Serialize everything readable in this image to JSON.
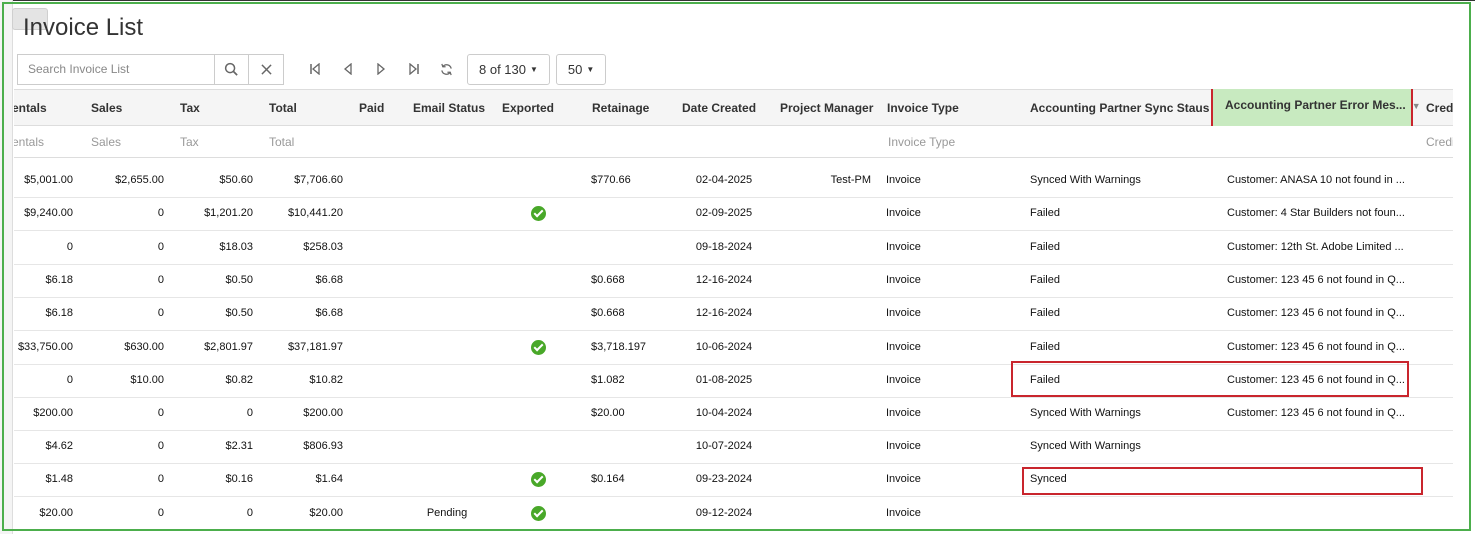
{
  "page": {
    "title": "Invoice List"
  },
  "toolbar": {
    "search_placeholder": "Search Invoice List",
    "pager_label": "8 of 130",
    "page_size": "50"
  },
  "columns": [
    {
      "key": "rentals",
      "label": "entals",
      "filter": "entals"
    },
    {
      "key": "sales",
      "label": "Sales",
      "filter": "Sales"
    },
    {
      "key": "tax",
      "label": "Tax",
      "filter": "Tax"
    },
    {
      "key": "total",
      "label": "Total",
      "filter": "Total"
    },
    {
      "key": "paid",
      "label": "Paid",
      "filter": ""
    },
    {
      "key": "email_status",
      "label": "Email Status",
      "filter": ""
    },
    {
      "key": "exported",
      "label": "Exported",
      "filter": ""
    },
    {
      "key": "retainage",
      "label": "Retainage",
      "filter": ""
    },
    {
      "key": "date_created",
      "label": "Date Created",
      "filter": ""
    },
    {
      "key": "project_manager",
      "label": "Project Manager",
      "filter": ""
    },
    {
      "key": "invoice_type",
      "label": "Invoice Type",
      "filter": "Invoice Type"
    },
    {
      "key": "sync_status",
      "label": "Accounting Partner Sync Staus",
      "filter": ""
    },
    {
      "key": "error_message",
      "label": "Accounting Partner Error Mes...",
      "filter": ""
    },
    {
      "key": "credit",
      "label": "Credi",
      "filter": "Credi"
    }
  ],
  "rows": [
    {
      "rentals": "$5,001.00",
      "sales": "$2,655.00",
      "tax": "$50.60",
      "total": "$7,706.60",
      "paid": "",
      "email_status": "",
      "exported": false,
      "retainage": "$770.66",
      "date_created": "02-04-2025",
      "project_manager": "Test-PM",
      "invoice_type": "Invoice",
      "sync_status": "Synced With Warnings",
      "error_message": "Customer: ANASA 10 not found in ..."
    },
    {
      "rentals": "$9,240.00",
      "sales": "0",
      "tax": "$1,201.20",
      "total": "$10,441.20",
      "paid": "",
      "email_status": "",
      "exported": true,
      "retainage": "",
      "date_created": "02-09-2025",
      "project_manager": "",
      "invoice_type": "Invoice",
      "sync_status": "Failed",
      "error_message": "Customer: 4 Star Builders not foun..."
    },
    {
      "rentals": "0",
      "sales": "0",
      "tax": "$18.03",
      "total": "$258.03",
      "paid": "",
      "email_status": "",
      "exported": false,
      "retainage": "",
      "date_created": "09-18-2024",
      "project_manager": "",
      "invoice_type": "Invoice",
      "sync_status": "Failed",
      "error_message": "Customer: 12th St. Adobe Limited ..."
    },
    {
      "rentals": "$6.18",
      "sales": "0",
      "tax": "$0.50",
      "total": "$6.68",
      "paid": "",
      "email_status": "",
      "exported": false,
      "retainage": "$0.668",
      "date_created": "12-16-2024",
      "project_manager": "",
      "invoice_type": "Invoice",
      "sync_status": "Failed",
      "error_message": "Customer: 123 45 6 not found in Q..."
    },
    {
      "rentals": "$6.18",
      "sales": "0",
      "tax": "$0.50",
      "total": "$6.68",
      "paid": "",
      "email_status": "",
      "exported": false,
      "retainage": "$0.668",
      "date_created": "12-16-2024",
      "project_manager": "",
      "invoice_type": "Invoice",
      "sync_status": "Failed",
      "error_message": "Customer: 123 45 6 not found in Q..."
    },
    {
      "rentals": "$33,750.00",
      "sales": "$630.00",
      "tax": "$2,801.97",
      "total": "$37,181.97",
      "paid": "",
      "email_status": "",
      "exported": true,
      "retainage": "$3,718.197",
      "date_created": "10-06-2024",
      "project_manager": "",
      "invoice_type": "Invoice",
      "sync_status": "Failed",
      "error_message": "Customer: 123 45 6 not found in Q..."
    },
    {
      "rentals": "0",
      "sales": "$10.00",
      "tax": "$0.82",
      "total": "$10.82",
      "paid": "",
      "email_status": "",
      "exported": false,
      "retainage": "$1.082",
      "date_created": "01-08-2025",
      "project_manager": "",
      "invoice_type": "Invoice",
      "sync_status": "Failed",
      "error_message": "Customer: 123 45 6 not found in Q..."
    },
    {
      "rentals": "$200.00",
      "sales": "0",
      "tax": "0",
      "total": "$200.00",
      "paid": "",
      "email_status": "",
      "exported": false,
      "retainage": "$20.00",
      "date_created": "10-04-2024",
      "project_manager": "",
      "invoice_type": "Invoice",
      "sync_status": "Synced With Warnings",
      "error_message": "Customer: 123 45 6 not found in Q..."
    },
    {
      "rentals": "$4.62",
      "sales": "0",
      "tax": "$2.31",
      "total": "$806.93",
      "paid": "",
      "email_status": "",
      "exported": false,
      "retainage": "",
      "date_created": "10-07-2024",
      "project_manager": "",
      "invoice_type": "Invoice",
      "sync_status": "Synced With Warnings",
      "error_message": ""
    },
    {
      "rentals": "$1.48",
      "sales": "0",
      "tax": "$0.16",
      "total": "$1.64",
      "paid": "",
      "email_status": "",
      "exported": true,
      "retainage": "$0.164",
      "date_created": "09-23-2024",
      "project_manager": "",
      "invoice_type": "Invoice",
      "sync_status": "Synced",
      "error_message": ""
    },
    {
      "rentals": "$20.00",
      "sales": "0",
      "tax": "0",
      "total": "$20.00",
      "paid": "",
      "email_status": "Pending",
      "exported": true,
      "retainage": "",
      "date_created": "09-12-2024",
      "project_manager": "",
      "invoice_type": "Invoice",
      "sync_status": "",
      "error_message": ""
    }
  ],
  "colors": {
    "frame": "#4cae4c",
    "highlight": "#c9252d",
    "active_header": "#c8eac0",
    "check": "#49a829"
  }
}
